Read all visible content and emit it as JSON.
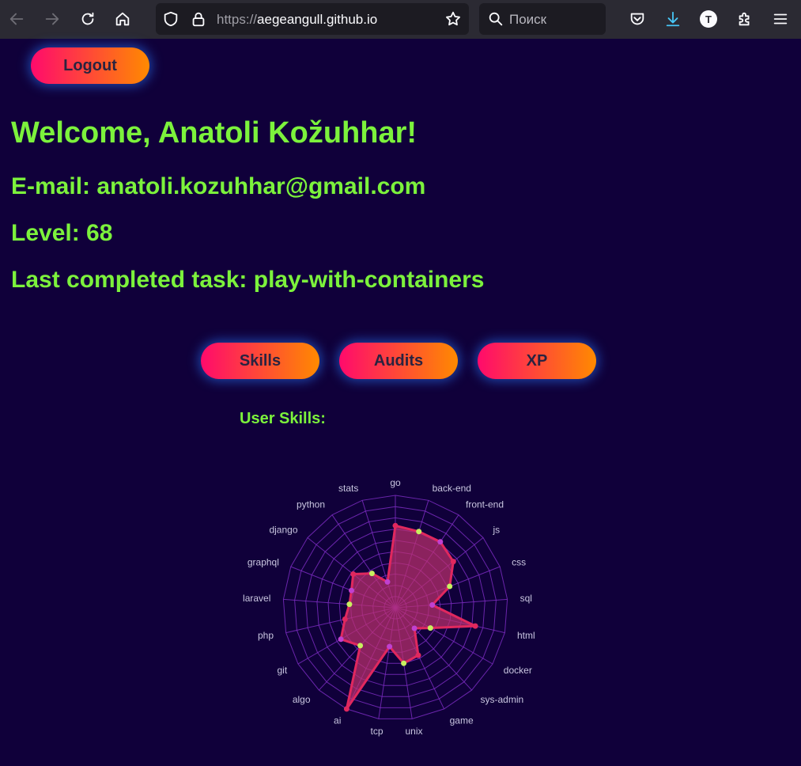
{
  "browser": {
    "url_scheme": "https://",
    "url_host": "aegeangull.github.io",
    "search_placeholder": "Поиск",
    "account_initial": "T"
  },
  "page": {
    "logout_label": "Logout",
    "welcome": "Welcome, Anatoli Kožuhhar!",
    "email": "E-mail: anatoli.kozuhhar@gmail.com",
    "level": "Level: 68",
    "last_task": "Last completed task: play-with-containers",
    "tabs": [
      {
        "label": "Skills"
      },
      {
        "label": "Audits"
      },
      {
        "label": "XP"
      }
    ],
    "skills_heading": "User Skills:"
  },
  "colors": {
    "background": "#10003a",
    "text_accent": "#7cf23c",
    "button_start": "#ff0a6c",
    "button_end": "#ff8a00",
    "radar_fill": "#c0306e",
    "radar_stroke": "#e0285e",
    "grid": "#7a2bbf"
  },
  "chart_data": {
    "type": "radar",
    "max": 100,
    "categories": [
      "go",
      "back-end",
      "front-end",
      "js",
      "css",
      "sql",
      "html",
      "docker",
      "sys-admin",
      "game",
      "unix",
      "tcp",
      "ai",
      "algo",
      "git",
      "php",
      "laravel",
      "graphql",
      "django",
      "python",
      "stats"
    ],
    "values": [
      73,
      71,
      71,
      66,
      52,
      33,
      73,
      36,
      25,
      47,
      50,
      35,
      100,
      46,
      56,
      46,
      41,
      42,
      48,
      37,
      24
    ]
  }
}
